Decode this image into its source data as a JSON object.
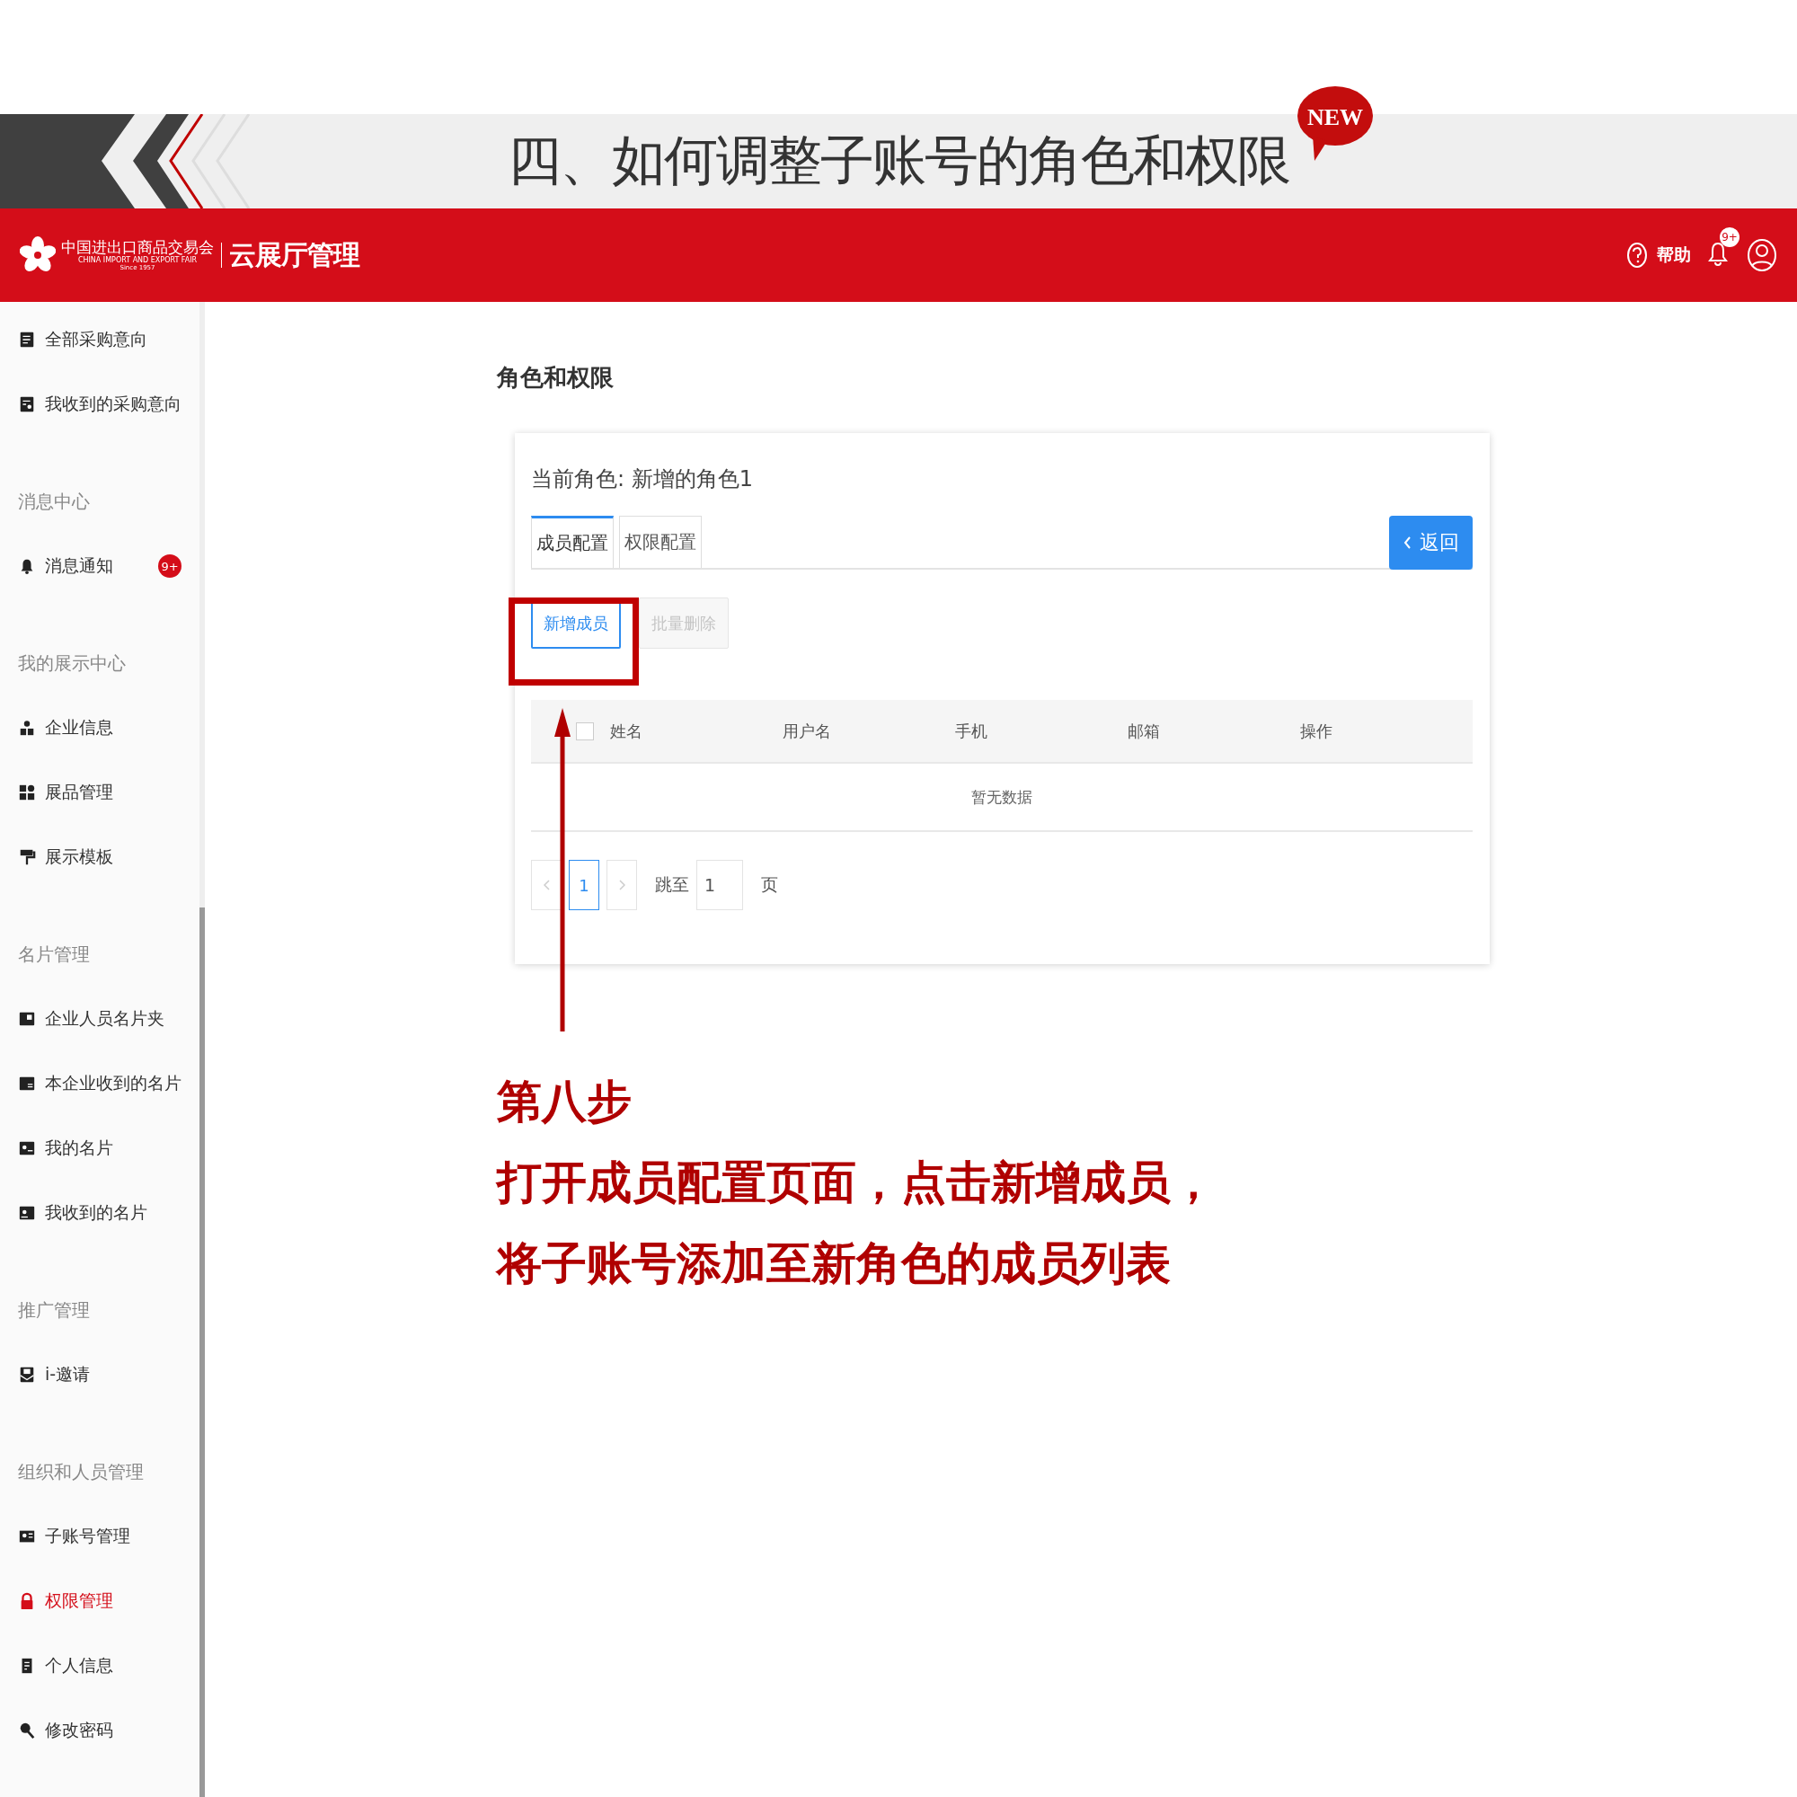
{
  "banner": {
    "title": "四、如何调整子账号的角色和权限",
    "badge": "NEW"
  },
  "header": {
    "logo_cn": "中国进出口商品交易会",
    "logo_en": "CHINA IMPORT AND EXPORT FAIR",
    "logo_since": "Since 1957",
    "app_name": "云展厅管理",
    "help": "帮助",
    "notification_badge": "9+"
  },
  "sidebar": {
    "groups": [
      {
        "items": [
          {
            "label": "全部采购意向",
            "selected": false
          },
          {
            "label": "我收到的采购意向",
            "selected": false
          }
        ]
      },
      {
        "label": "消息中心",
        "items": [
          {
            "label": "消息通知",
            "selected": false,
            "badge": "9+"
          }
        ]
      },
      {
        "label": "我的展示中心",
        "items": [
          {
            "label": "企业信息",
            "selected": false
          },
          {
            "label": "展品管理",
            "selected": false
          },
          {
            "label": "展示模板",
            "selected": false
          }
        ]
      },
      {
        "label": "名片管理",
        "items": [
          {
            "label": "企业人员名片夹",
            "selected": false
          },
          {
            "label": "本企业收到的名片",
            "selected": false
          },
          {
            "label": "我的名片",
            "selected": false
          },
          {
            "label": "我收到的名片",
            "selected": false
          }
        ]
      },
      {
        "label": "推广管理",
        "items": [
          {
            "label": "i-邀请",
            "selected": false
          }
        ]
      },
      {
        "label": "组织和人员管理",
        "items": [
          {
            "label": "子账号管理",
            "selected": false
          },
          {
            "label": "权限管理",
            "selected": true
          },
          {
            "label": "个人信息",
            "selected": false
          },
          {
            "label": "修改密码",
            "selected": false
          }
        ]
      }
    ]
  },
  "page": {
    "title": "角色和权限"
  },
  "card": {
    "current_role": "当前角色: 新增的角色1",
    "tabs": [
      {
        "label": "成员配置",
        "selected": true
      },
      {
        "label": "权限配置",
        "selected": false
      }
    ],
    "back_button": "返回",
    "actions": [
      {
        "label": "新增成员",
        "disabled": false
      },
      {
        "label": "批量删除",
        "disabled": true
      }
    ],
    "table": {
      "select_all_checked": false,
      "columns": [
        "姓名",
        "用户名",
        "手机",
        "邮箱",
        "操作"
      ],
      "empty_text": "暂无数据"
    },
    "pagination": {
      "pages": [
        {
          "label": "1",
          "selected": true
        }
      ],
      "jump_label": "跳至",
      "jump_value": "1",
      "page_suffix": "页"
    }
  },
  "annotation": {
    "lines": [
      "第八步",
      "打开成员配置页面，点击新增成员，",
      "将子账号添加至新角色的成员列表"
    ]
  }
}
